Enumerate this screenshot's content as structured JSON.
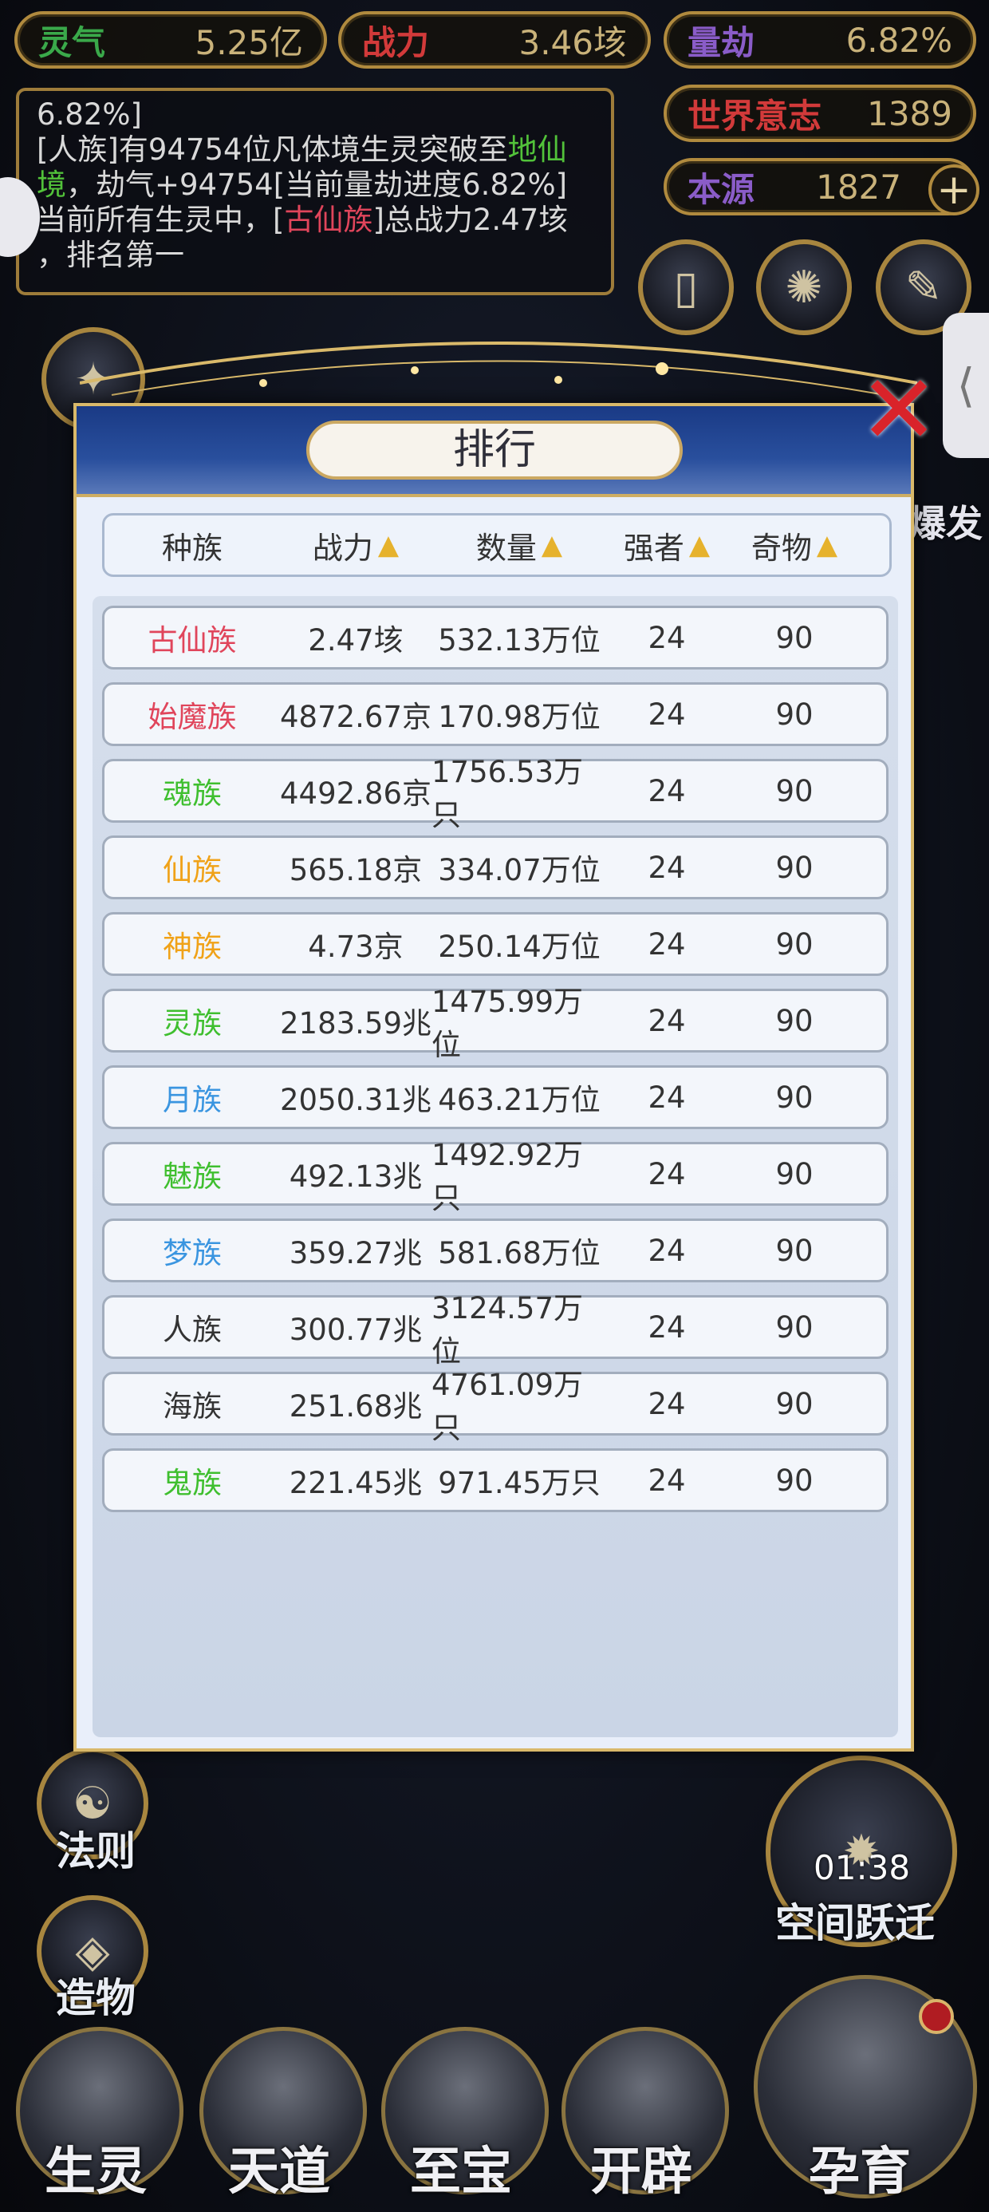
{
  "stats": {
    "lingqi": {
      "label": "灵气",
      "value": "5.25亿",
      "color": "#3aa94a"
    },
    "zhanli": {
      "label": "战力",
      "value": "3.46垓",
      "color": "#d23a3a"
    },
    "liangjie": {
      "label": "量劫",
      "value": "6.82%",
      "color": "#8a5cc8"
    },
    "shijie": {
      "label": "世界意志",
      "value": "1389",
      "color": "#d23a3a"
    },
    "benyuan": {
      "label": "本源",
      "value": "1827",
      "color": "#8a5cc8"
    }
  },
  "log": {
    "line0": "6.82%]",
    "line1_prefix": "[人族]有94754位凡体境生灵突破至",
    "line1_hl": "地仙",
    "line2_hl": "境",
    "line2_rest": "，劫气+94754[当前量劫进度6.82%]",
    "line3_prefix": "当前所有生灵中，[",
    "line3_hl": "古仙族",
    "line3_rest": "]总战力2.47垓",
    "line4": "，排名第一"
  },
  "side_labels": {
    "left_fa": "法则",
    "left_zaowu": "造物",
    "right_baofa": "爆发",
    "space_jump": "空间跃迁",
    "timer": "01:38"
  },
  "bottom_nav": [
    "生灵",
    "天道",
    "至宝",
    "开辟",
    "孕育"
  ],
  "modal": {
    "title": "排行",
    "headers": {
      "race": "种族",
      "power": "战力",
      "count": "数量",
      "strong": "强者",
      "relic": "奇物"
    },
    "sort_icon": "▲",
    "rows": [
      {
        "race": "古仙族",
        "power": "2.47垓",
        "count": "532.13万位",
        "strong": "24",
        "relic": "90",
        "color": "#e0455b"
      },
      {
        "race": "始魔族",
        "power": "4872.67京",
        "count": "170.98万位",
        "strong": "24",
        "relic": "90",
        "color": "#e0455b"
      },
      {
        "race": "魂族",
        "power": "4492.86京",
        "count": "1756.53万只",
        "strong": "24",
        "relic": "90",
        "color": "#3fbf2f"
      },
      {
        "race": "仙族",
        "power": "565.18京",
        "count": "334.07万位",
        "strong": "24",
        "relic": "90",
        "color": "#f0a218"
      },
      {
        "race": "神族",
        "power": "4.73京",
        "count": "250.14万位",
        "strong": "24",
        "relic": "90",
        "color": "#f0a218"
      },
      {
        "race": "灵族",
        "power": "2183.59兆",
        "count": "1475.99万位",
        "strong": "24",
        "relic": "90",
        "color": "#3fbf2f"
      },
      {
        "race": "月族",
        "power": "2050.31兆",
        "count": "463.21万位",
        "strong": "24",
        "relic": "90",
        "color": "#3a95e0"
      },
      {
        "race": "魅族",
        "power": "492.13兆",
        "count": "1492.92万只",
        "strong": "24",
        "relic": "90",
        "color": "#3fbf2f"
      },
      {
        "race": "梦族",
        "power": "359.27兆",
        "count": "581.68万位",
        "strong": "24",
        "relic": "90",
        "color": "#3a95e0"
      },
      {
        "race": "人族",
        "power": "300.77兆",
        "count": "3124.57万位",
        "strong": "24",
        "relic": "90",
        "color": "#333333"
      },
      {
        "race": "海族",
        "power": "251.68兆",
        "count": "4761.09万只",
        "strong": "24",
        "relic": "90",
        "color": "#333333"
      },
      {
        "race": "鬼族",
        "power": "221.45兆",
        "count": "971.45万只",
        "strong": "24",
        "relic": "90",
        "color": "#3fbf2f"
      }
    ]
  }
}
